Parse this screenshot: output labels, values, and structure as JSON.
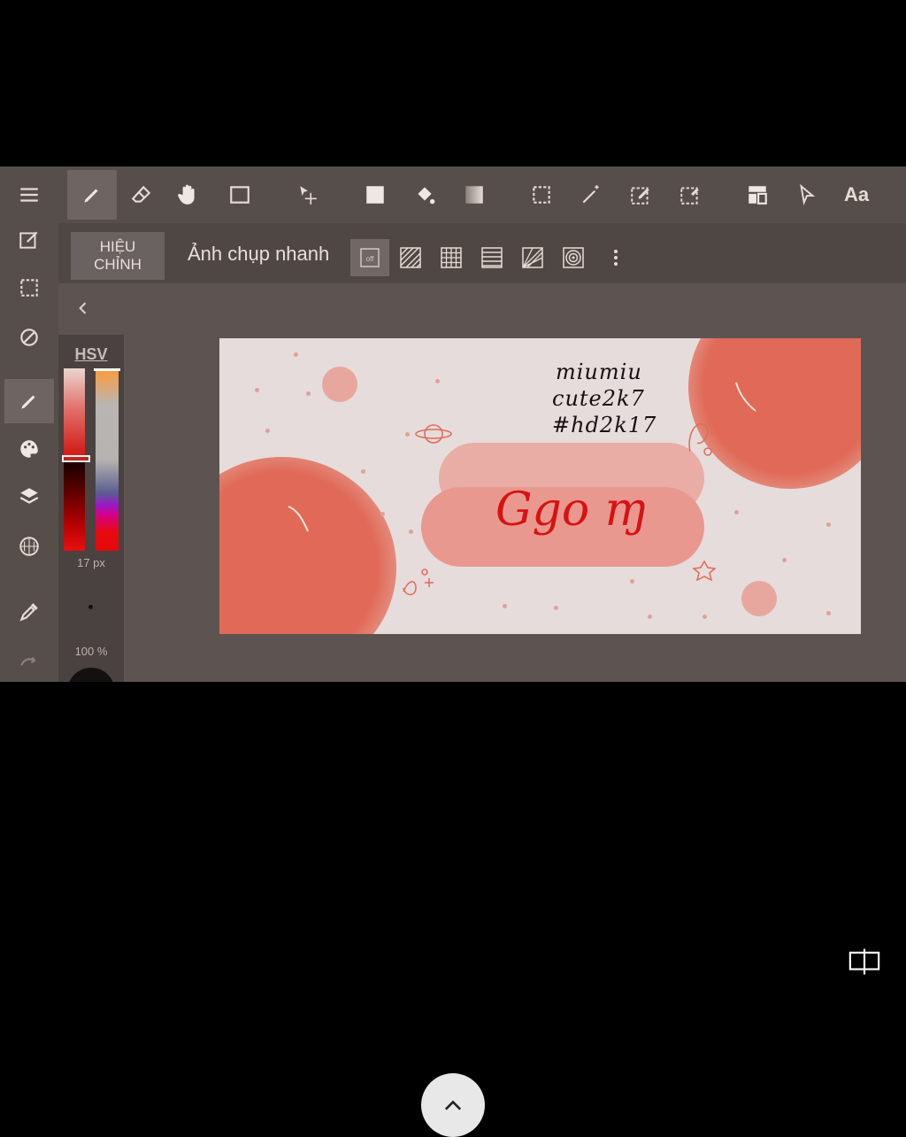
{
  "toolbar": {
    "tools": [
      {
        "name": "menu"
      },
      {
        "name": "pen"
      },
      {
        "name": "eraser"
      },
      {
        "name": "hand"
      },
      {
        "name": "rectangle"
      },
      {
        "name": "move"
      },
      {
        "name": "fill-square"
      },
      {
        "name": "bucket"
      },
      {
        "name": "gradient"
      },
      {
        "name": "select-rect"
      },
      {
        "name": "magic-wand"
      },
      {
        "name": "select-edit"
      },
      {
        "name": "select-pen"
      },
      {
        "name": "layout"
      },
      {
        "name": "pointer"
      }
    ],
    "text_tool_label": "Aa"
  },
  "subbar": {
    "adjust_label": "HIỆU\nCHỈNH",
    "snapshot_label": "Ảnh chụp nhanh",
    "snap_off_label": "off"
  },
  "color_panel": {
    "mode": "HSV",
    "size": "17 px",
    "opacity": "100 %",
    "current_color": "#151010"
  },
  "canvas": {
    "handwriting_lines": [
      "miumiu",
      "cute2k7",
      "#hd2k17"
    ],
    "title_text": "Ggo ɱ",
    "colors": {
      "blob": "#e06a57",
      "pill": "#e9988f",
      "title": "#d81212"
    }
  }
}
